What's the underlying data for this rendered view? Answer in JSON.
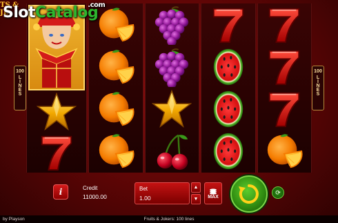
{
  "watermark": {
    "slot": "Slot",
    "catalog": "Catalog",
    "com": ".com"
  },
  "logo": {
    "text": "TS & JE"
  },
  "side_lines": {
    "number": "100",
    "word": "LINES"
  },
  "reels": [
    [
      "joker",
      "joker",
      "star",
      "seven"
    ],
    [
      "orange",
      "orange",
      "orange",
      "orange"
    ],
    [
      "grapes",
      "grapes",
      "star",
      "cherry"
    ],
    [
      "seven",
      "watermelon",
      "watermelon",
      "watermelon"
    ],
    [
      "seven",
      "seven",
      "seven",
      "orange"
    ]
  ],
  "controls": {
    "info_label": "i",
    "credit_label": "Credit",
    "credit_value": "11000.00",
    "bet_label": "Bet",
    "bet_value": "1.00",
    "bet_up": "▲",
    "bet_down": "▼",
    "max_label": "MAX",
    "autoplay_icon": "autoplay-icon",
    "spin_icon": "spin-arrow-icon"
  },
  "footer": {
    "provider": "by Playson",
    "title": "Fruits & Jokers: 100 lines"
  },
  "colors": {
    "background": "#6a0808",
    "spin_button": "#3aa81a",
    "red_button": "#c41212",
    "gold": "#f0b630"
  }
}
